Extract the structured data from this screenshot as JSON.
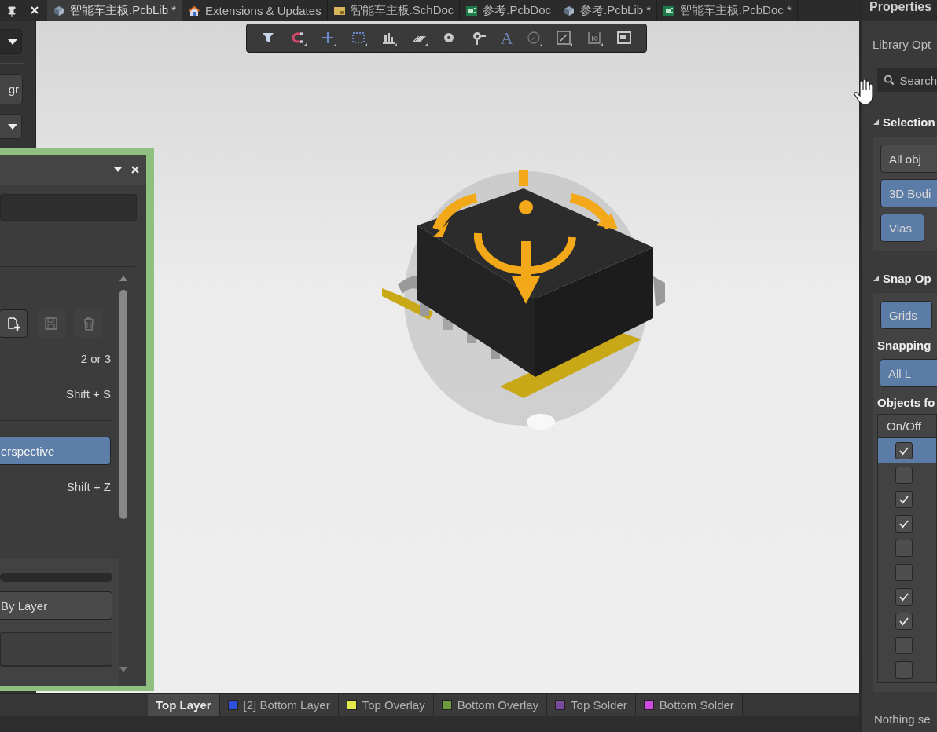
{
  "tabbar": {
    "tabs": [
      {
        "label": "智能车主板.PcbLib *",
        "kind": "pcblib",
        "selected": true
      },
      {
        "label": "Extensions & Updates",
        "kind": "home",
        "selected": false
      },
      {
        "label": "智能车主板.SchDoc",
        "kind": "schdoc",
        "selected": false
      },
      {
        "label": "参考.PcbDoc",
        "kind": "pcbdoc",
        "selected": false
      },
      {
        "label": "参考.PcbLib *",
        "kind": "pcblib",
        "selected": false
      },
      {
        "label": "智能车主板.PcbDoc *",
        "kind": "pcbdoc",
        "selected": false
      }
    ]
  },
  "left_strip": {
    "button_label": "gr"
  },
  "canvas_toolbar": {
    "text_tool_glyph": "A"
  },
  "floating_panel": {
    "shortcut_1": "2 or 3",
    "shortcut_2": "Shift + S",
    "projection_button": {
      "label": "erspective",
      "selected": true
    },
    "shortcut_3": "Shift + Z",
    "color_button": {
      "label": "By Layer",
      "selected": false
    }
  },
  "layer_tabs": [
    {
      "label": "Top Layer",
      "selected": true
    },
    {
      "label": "[2] Bottom Layer",
      "color": "#2f4fd8",
      "selected": false
    },
    {
      "label": "Top Overlay",
      "color": "#e4e84a",
      "selected": false
    },
    {
      "label": "Bottom Overlay",
      "color": "#6e9a3c",
      "selected": false
    },
    {
      "label": "Top Solder",
      "color": "#7a4a9c",
      "selected": false
    },
    {
      "label": "Bottom Solder",
      "color": "#d048e0",
      "selected": false
    }
  ],
  "properties": {
    "title": "Properties",
    "subtitle": "Library Opt",
    "search": {
      "placeholder": "Search"
    },
    "selection": {
      "title": "Selection",
      "expanded": true,
      "buttons": [
        {
          "label": "All obj",
          "selected": false
        },
        {
          "label": "3D Bodi",
          "selected": true
        },
        {
          "label": "Vias",
          "selected": true
        }
      ]
    },
    "snap": {
      "title": "Snap Op",
      "expanded": true,
      "buttons": [
        {
          "label": "Grids",
          "selected": true
        }
      ],
      "snapping_label": "Snapping",
      "snapping_buttons": [
        {
          "label": "All L",
          "selected": true
        }
      ]
    },
    "objects": {
      "title": "Objects fo",
      "column": "On/Off",
      "rows": [
        {
          "checked": true,
          "selected": true
        },
        {
          "checked": false,
          "selected": false
        },
        {
          "checked": true,
          "selected": false
        },
        {
          "checked": true,
          "selected": false
        },
        {
          "checked": false,
          "selected": false
        },
        {
          "checked": false,
          "selected": false
        },
        {
          "checked": true,
          "selected": false
        },
        {
          "checked": true,
          "selected": false
        },
        {
          "checked": false,
          "selected": false
        },
        {
          "checked": false,
          "selected": false
        }
      ]
    },
    "status": "Nothing se"
  }
}
